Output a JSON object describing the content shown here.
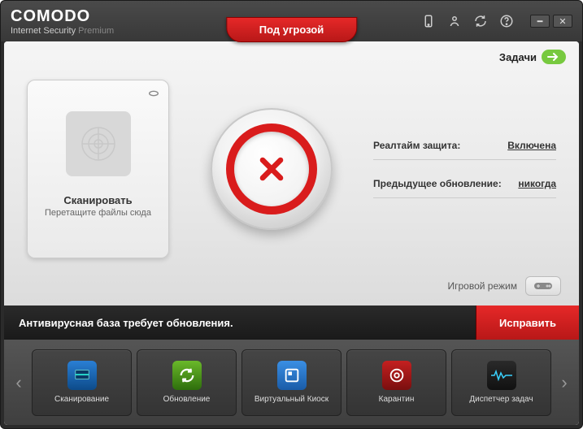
{
  "brand": {
    "name": "COMODO",
    "subline": "Internet Security ",
    "premium": "Premium"
  },
  "status_ribbon": "Под угрозой",
  "tasks": {
    "label": "Задачи"
  },
  "scan_card": {
    "title": "Сканировать",
    "sub": "Перетащите файлы сюда"
  },
  "info": {
    "realtime_label": "Реалтайм защита:",
    "realtime_value": "Включена",
    "update_label": "Предыдущее обновление:",
    "update_value": "никогда"
  },
  "game_mode": {
    "label": "Игровой режим"
  },
  "alert": {
    "message": "Антивирусная база требует обновления.",
    "fix": "Исправить"
  },
  "quick": [
    {
      "label": "Сканирование"
    },
    {
      "label": "Обновление"
    },
    {
      "label": "Виртуальный Киоск"
    },
    {
      "label": "Карантин"
    },
    {
      "label": "Диспетчер задач"
    }
  ]
}
